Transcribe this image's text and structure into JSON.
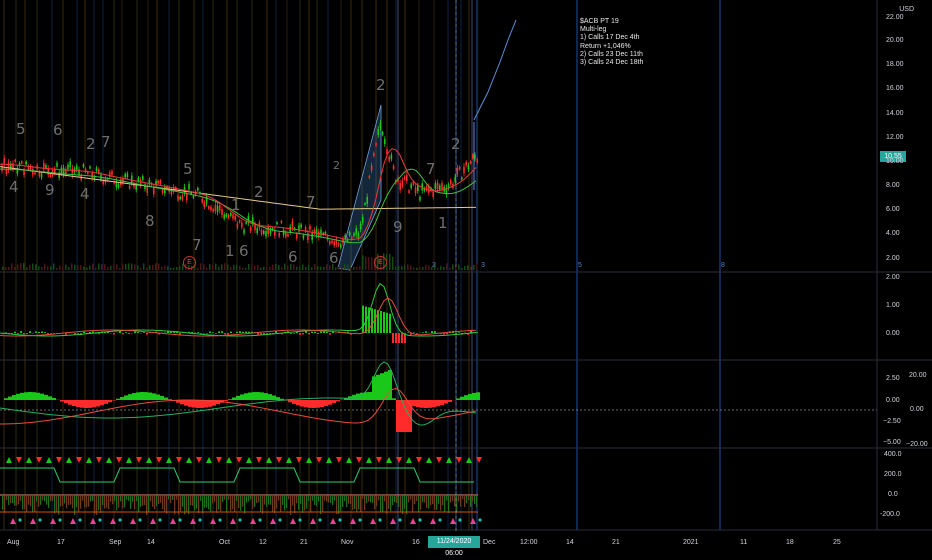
{
  "header": {
    "currency": "USD"
  },
  "annotation": {
    "lines": [
      "$ACB PT 19",
      "Multi-leg",
      "1) Calls 17 Dec 4th",
      "Return +1,046%",
      "2) Calls 23 Dec 11th",
      "3) Calls 24 Dec 18th"
    ]
  },
  "price_tag": "10.55",
  "cursor_date": "11/24/2020",
  "cursor_time": "06:00",
  "price_axis": [
    "22.00",
    "20.00",
    "18.00",
    "16.00",
    "14.00",
    "12.00",
    "10.00",
    "8.00",
    "6.00",
    "4.00",
    "2.00"
  ],
  "macd_axis": [
    "2.00",
    "1.00",
    "0.00"
  ],
  "osc_axis": [
    "2.50",
    "0.00",
    "−2.50",
    "−5.00"
  ],
  "osc_right_axis": [
    "20.00",
    "0.00",
    "−20.00"
  ],
  "cci_axis": [
    "400.0",
    "200.0",
    "0.0",
    "-200.0"
  ],
  "time_axis": [
    "Aug",
    "17",
    "Sep",
    "14",
    "Oct",
    "12",
    "21",
    "Nov",
    "16",
    "Dec",
    "12:00",
    "14",
    "21",
    "2021",
    "11",
    "18",
    "25"
  ],
  "count_labels": [
    "5",
    "6",
    "2",
    "7",
    "4",
    "9",
    "4",
    "8",
    "5",
    "7",
    "2",
    "1",
    "1",
    "6",
    "6",
    "7",
    "6",
    "2",
    "9",
    "1",
    "2",
    "7",
    "2"
  ],
  "earnings_labels": [
    "E",
    "E"
  ],
  "vline_labels": [
    "2",
    "3",
    "5",
    "8"
  ],
  "colors": {
    "bull": "#19c819",
    "bear": "#ff2a2a",
    "sma_slow": "#e6c98a",
    "accent": "#26a69a",
    "grid_blue": "#1f4ea8",
    "channel": "#3a6ea5"
  },
  "chart_data": {
    "type": "candlestick",
    "x": [
      "Aug",
      "17",
      "Sep",
      "14",
      "Oct",
      "12",
      "21",
      "Nov",
      "16",
      "Dec"
    ],
    "price_close_approx": [
      10.0,
      9.6,
      9.4,
      8.7,
      8.1,
      7.4,
      5.0,
      4.7,
      4.1,
      3.6,
      4.3,
      13.5,
      9.0,
      7.6,
      8.3,
      10.55
    ],
    "ylim": [
      2,
      22
    ],
    "projection_target": 19,
    "last_price": 10.55
  }
}
